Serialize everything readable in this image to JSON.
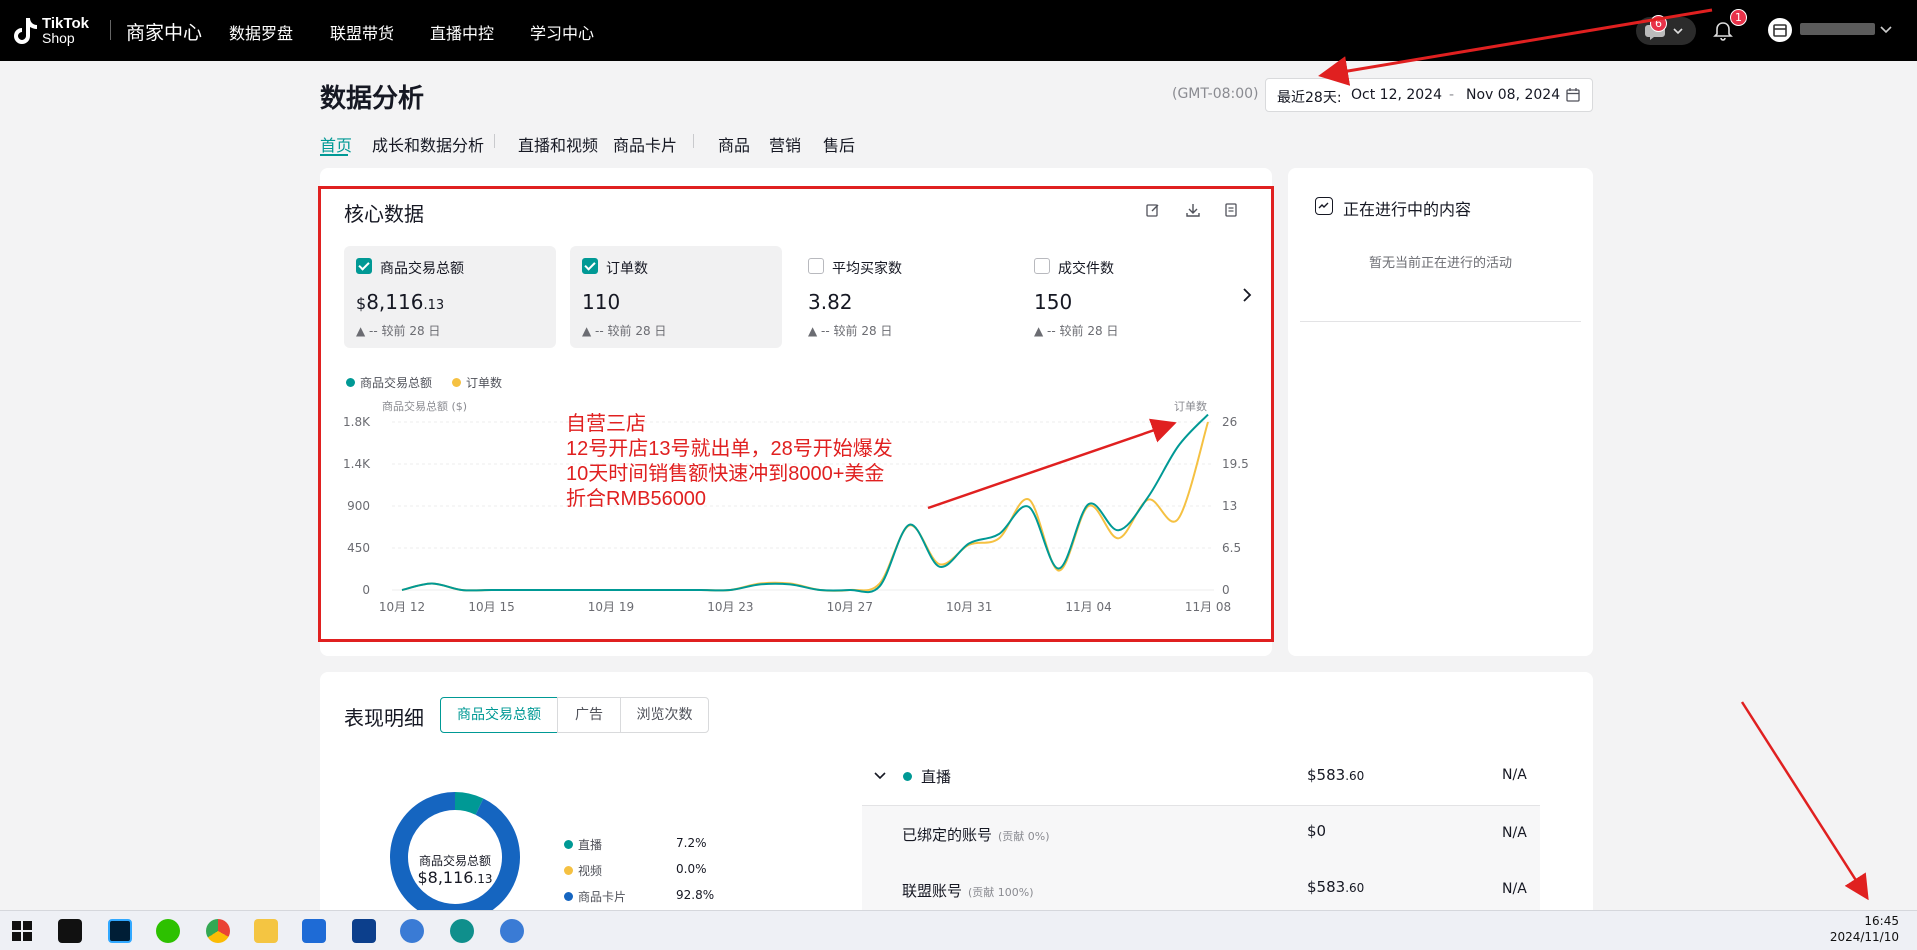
{
  "topbar": {
    "logo_line1": "TikTok",
    "logo_line2": "Shop",
    "app_title": "商家中心",
    "nav": [
      "数据罗盘",
      "联盟带货",
      "直播中控",
      "学习中心"
    ],
    "message_badge": "6",
    "bell_badge": "1"
  },
  "page": {
    "title": "数据分析",
    "timezone": "(GMT-08:00)",
    "date_prefix": "最近28天:",
    "date_start": "Oct 12, 2024",
    "date_sep": "-",
    "date_end": "Nov 08, 2024",
    "tabs": [
      "首页",
      "成长和数据分析",
      "直播和视频",
      "商品卡片",
      "商品",
      "营销",
      "售后"
    ]
  },
  "core": {
    "title": "核心数据",
    "metrics": [
      {
        "label": "商品交易总额",
        "currency": "$",
        "int": "8,116",
        "dec": ".13",
        "comparison": "▲ --  较前 28 日",
        "selected": true
      },
      {
        "label": "订单数",
        "currency": "",
        "int": "110",
        "dec": "",
        "comparison": "▲ --  较前 28 日",
        "selected": true
      },
      {
        "label": "平均买家数",
        "currency": "",
        "int": "3.82",
        "dec": "",
        "comparison": "▲ --  较前 28 日",
        "selected": false
      },
      {
        "label": "成交件数",
        "currency": "",
        "int": "150",
        "dec": "",
        "comparison": "▲ --  较前 28 日",
        "selected": false
      }
    ]
  },
  "chart_data": {
    "type": "line",
    "x": [
      "10月 12",
      "10月 13",
      "10月 14",
      "10月 15",
      "10月 16",
      "10月 17",
      "10月 18",
      "10月 19",
      "10月 20",
      "10月 21",
      "10月 22",
      "10月 23",
      "10月 24",
      "10月 25",
      "10月 26",
      "10月 27",
      "10月 28",
      "10月 29",
      "10月 30",
      "10月 31",
      "11月 01",
      "11月 02",
      "11月 03",
      "11月 04",
      "11月 05",
      "11月 06",
      "11月 07",
      "11月 08"
    ],
    "xticks": [
      "10月 12",
      "10月 15",
      "10月 19",
      "10月 23",
      "10月 27",
      "10月 31",
      "11月 04",
      "11月 08"
    ],
    "series": [
      {
        "name": "商品交易总额",
        "color": "#009995",
        "axis": "left",
        "values": [
          0,
          70,
          0,
          0,
          0,
          0,
          0,
          0,
          0,
          0,
          0,
          0,
          60,
          60,
          0,
          0,
          40,
          700,
          250,
          500,
          600,
          890,
          230,
          920,
          640,
          1000,
          1540,
          1880
        ]
      },
      {
        "name": "订单数",
        "color": "#f5c142",
        "axis": "right",
        "values": [
          0,
          1,
          0,
          0,
          0,
          0,
          0,
          0,
          0,
          0,
          0,
          0,
          1,
          1,
          0,
          0,
          1,
          10,
          4,
          7,
          8,
          14,
          3,
          13,
          8,
          14,
          11,
          26
        ]
      }
    ],
    "left_axis_title": "商品交易总额 ($)",
    "right_axis_title": "订单数",
    "left_ticks": [
      "0",
      "450",
      "900",
      "1.4K",
      "1.8K"
    ],
    "right_ticks": [
      "0",
      "6.5",
      "13",
      "19.5",
      "26"
    ],
    "ylim_left": [
      0,
      1800
    ],
    "ylim_right": [
      0,
      26
    ]
  },
  "annotation": {
    "lines": [
      "自营三店",
      "12号开店13号就出单，28号开始爆发",
      "10天时间销售额快速冲到8000+美金",
      "折合RMB56000"
    ],
    "color": "#e02020"
  },
  "live": {
    "title": "正在进行中的内容",
    "empty_text": "暂无当前正在进行的活动"
  },
  "performance": {
    "title": "表现明细",
    "segments": [
      "商品交易总额",
      "广告",
      "浏览次数"
    ],
    "donut_label": "商品交易总额",
    "donut_currency": "$",
    "donut_int": "8,116",
    "donut_dec": ".13",
    "breakdown": [
      {
        "name": "直播",
        "pct": "7.2%",
        "color": "#009995",
        "value": 7.2
      },
      {
        "name": "视频",
        "pct": "0.0%",
        "color": "#f5c142",
        "value": 0.0
      },
      {
        "name": "商品卡片",
        "pct": "92.8%",
        "color": "#1565c0",
        "value": 92.8
      }
    ],
    "rows": [
      {
        "name": "直播",
        "sub": "",
        "currency": "$",
        "amount": "583",
        "dec": ".60",
        "na": "N/A"
      },
      {
        "name": "已绑定的账号",
        "sub": "(贡献 0%)",
        "currency": "$",
        "amount": "0",
        "dec": "",
        "na": "N/A"
      },
      {
        "name": "联盟账号",
        "sub": "(贡献 100%)",
        "currency": "$",
        "amount": "583",
        "dec": ".60",
        "na": "N/A"
      }
    ]
  },
  "taskbar": {
    "time": "16:45",
    "date": "2024/11/10"
  }
}
